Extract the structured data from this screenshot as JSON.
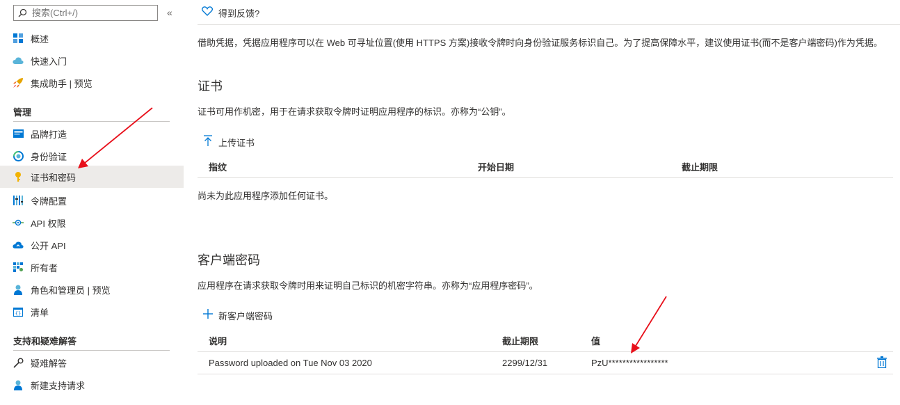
{
  "sidebar": {
    "search_placeholder": "搜索(Ctrl+/)",
    "collapse_glyph": "«",
    "items_top": [
      {
        "label": "概述",
        "icon": "overview-grid-icon"
      },
      {
        "label": "快速入门",
        "icon": "cloud-quickstart-icon"
      },
      {
        "label": "集成助手 | 预览",
        "icon": "rocket-icon"
      }
    ],
    "manage_header": "管理",
    "items_manage": [
      {
        "label": "品牌打造",
        "icon": "branding-icon"
      },
      {
        "label": "身份验证",
        "icon": "authentication-icon"
      },
      {
        "label": "证书和密码",
        "icon": "key-icon",
        "active": true
      },
      {
        "label": "令牌配置",
        "icon": "token-bars-icon"
      },
      {
        "label": "API 权限",
        "icon": "api-permissions-icon"
      },
      {
        "label": "公开 API",
        "icon": "cloud-api-icon"
      },
      {
        "label": "所有者",
        "icon": "owners-grid-icon"
      },
      {
        "label": "角色和管理员 | 预览",
        "icon": "roles-admin-icon"
      },
      {
        "label": "清单",
        "icon": "manifest-icon"
      }
    ],
    "support_header": "支持和疑难解答",
    "items_support": [
      {
        "label": "疑难解答",
        "icon": "wrench-icon"
      },
      {
        "label": "新建支持请求",
        "icon": "support-person-icon"
      }
    ]
  },
  "main": {
    "feedback_label": "得到反馈?",
    "intro": "借助凭据，凭据应用程序可以在 Web 可寻址位置(使用 HTTPS 方案)接收令牌时向身份验证服务标识自己。为了提高保障水平，建议使用证书(而不是客户端密码)作为凭据。",
    "certificates": {
      "title": "证书",
      "desc": "证书可用作机密，用于在请求获取令牌时证明应用程序的标识。亦称为“公钥”。",
      "upload_label": "上传证书",
      "columns": [
        "指纹",
        "开始日期",
        "截止期限"
      ],
      "empty_text": "尚未为此应用程序添加任何证书。"
    },
    "secrets": {
      "title": "客户端密码",
      "desc": "应用程序在请求获取令牌时用来证明自己标识的机密字符串。亦称为“应用程序密码”。",
      "new_label": "新客户端密码",
      "columns": [
        "说明",
        "截止期限",
        "值"
      ],
      "rows": [
        {
          "description": "Password uploaded on Tue Nov 03 2020",
          "expires": "2299/12/31",
          "value": "PzU*****************"
        }
      ]
    }
  },
  "colors": {
    "accent": "#0078d4",
    "arrow": "#e8101b",
    "active_bg": "#edebe9"
  }
}
